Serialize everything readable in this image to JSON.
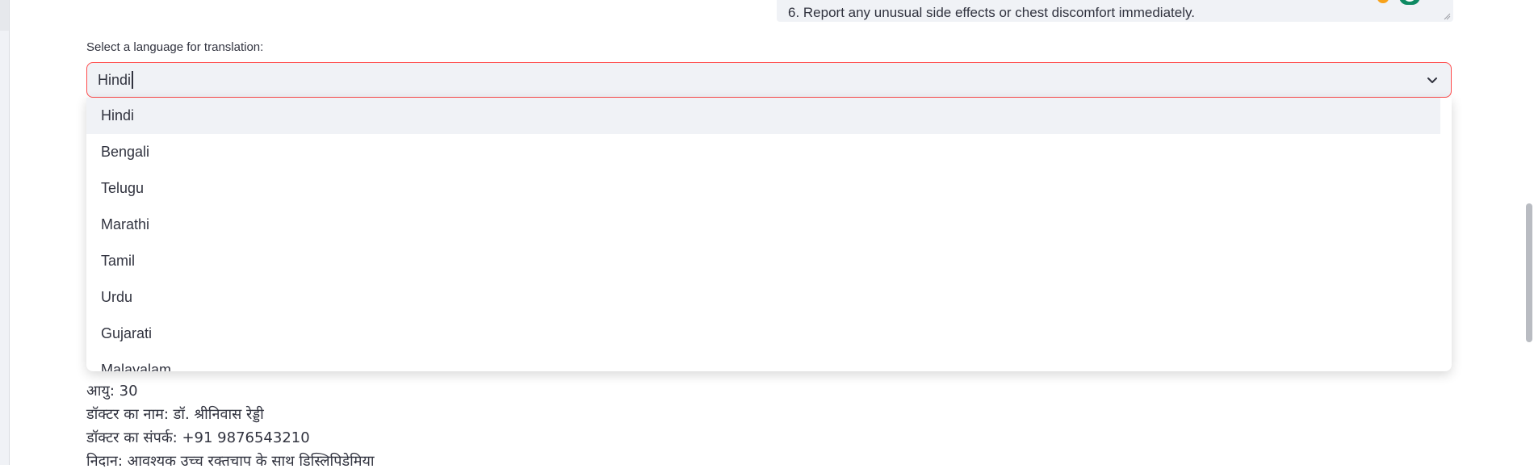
{
  "instructions_box": {
    "last_line": "6. Report any unusual side effects or chest discomfort immediately."
  },
  "language_select": {
    "label": "Select a language for translation:",
    "current_value": "Hindi",
    "options": [
      "Hindi",
      "Bengali",
      "Telugu",
      "Marathi",
      "Tamil",
      "Urdu",
      "Gujarati",
      "Malayalam"
    ],
    "highlighted_option": "Hindi"
  },
  "translated_text": {
    "lines": [
      "आयु: 30",
      "डॉक्टर का नाम: डॉ. श्रीनिवास रेड्डी",
      "डॉक्टर का संपर्क: +91 9876543210",
      "निदान: आवश्यक उच्च रक्तचाप के साथ डिस्लिपिडेमिया"
    ]
  },
  "colors": {
    "focus_border": "#ff4b4b",
    "input_background": "#f0f2f6",
    "text": "#31333f"
  },
  "icons": {
    "select_toggle": "chevron-down-icon",
    "textarea_resize": "resize-grip-icon"
  }
}
